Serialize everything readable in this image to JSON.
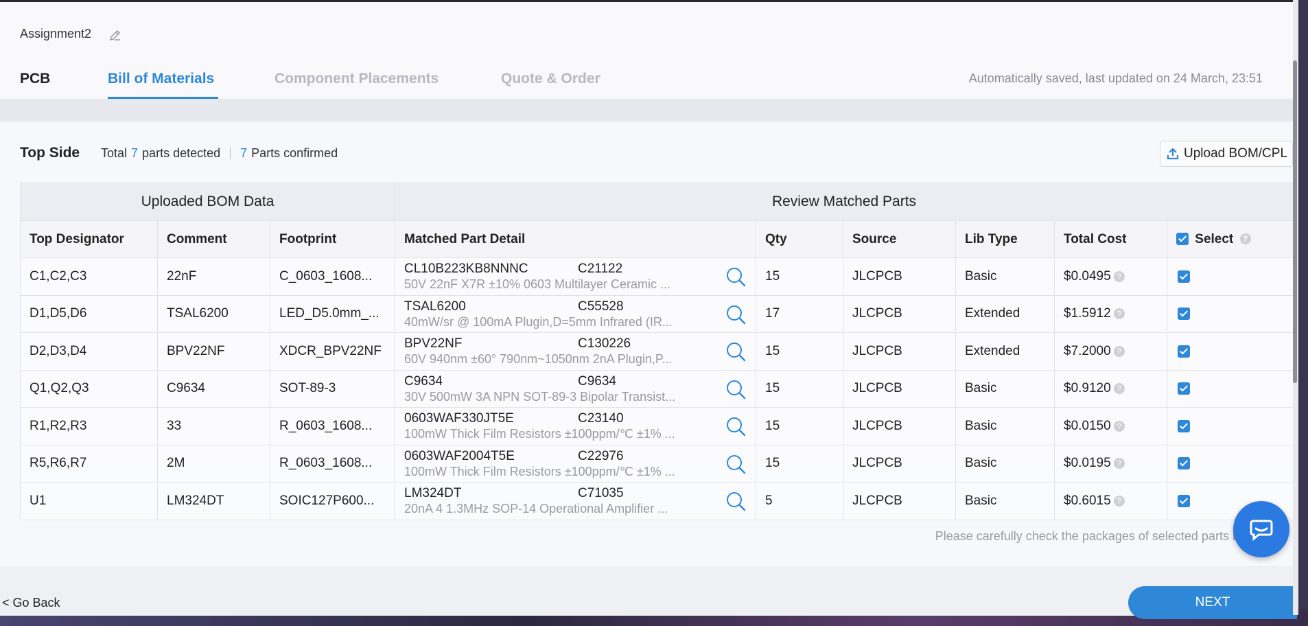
{
  "header": {
    "project_name": "Assignment2",
    "tabs": [
      "PCB",
      "Bill of Materials",
      "Component Placements",
      "Quote & Order"
    ],
    "active_tab": "Bill of Materials",
    "saved_status": "Automatically saved, last updated on 24 March, 23:51"
  },
  "summary": {
    "title": "Top Side",
    "total_label": "Total",
    "detected_count": "7",
    "detected_label": "parts detected",
    "confirmed_count": "7",
    "confirmed_label": "Parts confirmed",
    "upload_label": "Upload BOM/CPL"
  },
  "table": {
    "group_uploaded": "Uploaded BOM Data",
    "group_review": "Review Matched Parts",
    "columns": [
      "Top Designator",
      "Comment",
      "Footprint",
      "Matched Part Detail",
      "Qty",
      "Source",
      "Lib Type",
      "Total Cost",
      "Select"
    ],
    "rows": [
      {
        "designator": "C1,C2,C3",
        "comment": "22nF",
        "footprint": "C_0603_1608...",
        "mpn": "CL10B223KB8NNNC",
        "lcsc": "C21122",
        "desc": "50V 22nF X7R ±10% 0603 Multilayer Ceramic ...",
        "qty": "15",
        "source": "JLCPCB",
        "lib": "Basic",
        "cost": "$0.0495"
      },
      {
        "designator": "D1,D5,D6",
        "comment": "TSAL6200",
        "footprint": "LED_D5.0mm_...",
        "mpn": "TSAL6200",
        "lcsc": "C55528",
        "desc": "40mW/sr @ 100mA Plugin,D=5mm Infrared (IR...",
        "qty": "17",
        "source": "JLCPCB",
        "lib": "Extended",
        "cost": "$1.5912"
      },
      {
        "designator": "D2,D3,D4",
        "comment": "BPV22NF",
        "footprint": "XDCR_BPV22NF",
        "mpn": "BPV22NF",
        "lcsc": "C130226",
        "desc": "60V 940nm ±60° 790nm~1050nm 2nA Plugin,P...",
        "qty": "15",
        "source": "JLCPCB",
        "lib": "Extended",
        "cost": "$7.2000"
      },
      {
        "designator": "Q1,Q2,Q3",
        "comment": "C9634",
        "footprint": "SOT-89-3",
        "mpn": "C9634",
        "lcsc": "C9634",
        "desc": "30V 500mW 3A NPN SOT-89-3 Bipolar Transist...",
        "qty": "15",
        "source": "JLCPCB",
        "lib": "Basic",
        "cost": "$0.9120"
      },
      {
        "designator": "R1,R2,R3",
        "comment": "33",
        "footprint": "R_0603_1608...",
        "mpn": "0603WAF330JT5E",
        "lcsc": "C23140",
        "desc": "100mW Thick Film Resistors ±100ppm/℃ ±1% ...",
        "qty": "15",
        "source": "JLCPCB",
        "lib": "Basic",
        "cost": "$0.0150"
      },
      {
        "designator": "R5,R6,R7",
        "comment": "2M",
        "footprint": "R_0603_1608...",
        "mpn": "0603WAF2004T5E",
        "lcsc": "C22976",
        "desc": "100mW Thick Film Resistors ±100ppm/℃ ±1% ...",
        "qty": "15",
        "source": "JLCPCB",
        "lib": "Basic",
        "cost": "$0.0195"
      },
      {
        "designator": "U1",
        "comment": "LM324DT",
        "footprint": "SOIC127P600...",
        "mpn": "LM324DT",
        "lcsc": "C71035",
        "desc": "20nA 4 1.3MHz SOP-14 Operational Amplifier ...",
        "qty": "5",
        "source": "JLCPCB",
        "lib": "Basic",
        "cost": "$0.6015"
      }
    ]
  },
  "note": "Please carefully check the packages of selected parts before pr",
  "footer": {
    "back_label": "< Go Back",
    "next_label": "NEXT"
  },
  "colors": {
    "accent": "#2f87d8",
    "muted": "#9a9aa0",
    "chat": "#2a7ae2"
  }
}
